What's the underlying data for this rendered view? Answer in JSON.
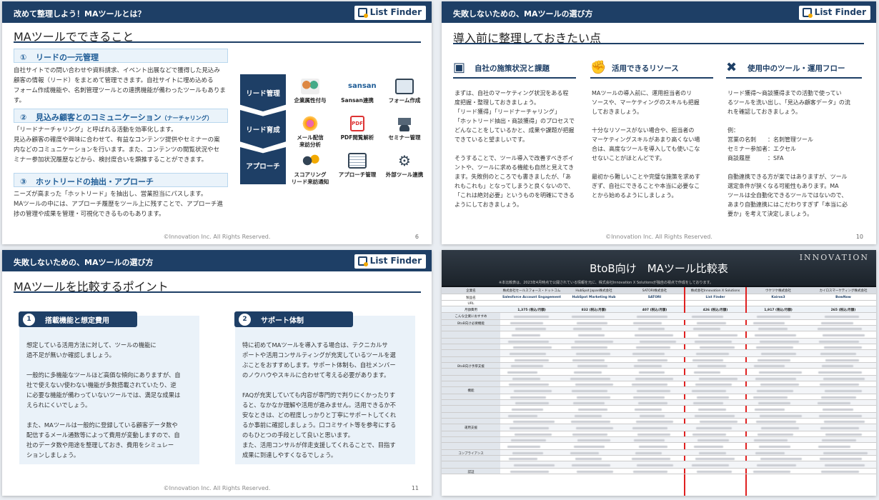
{
  "slide1": {
    "header": "改めて整理しよう！MAツールとは？",
    "logo": "List Finder",
    "title": "MAツールでできること",
    "sec1": {
      "num": "①",
      "label": "リードの一元管理"
    },
    "para1": [
      "自社サイトでの問い合わせや資料請求、イベント出展などで獲得した見込み",
      "顧客の情報（リード）をまとめて管理できます。自社サイトに埋め込める",
      "フォーム作成機能や、名刺管理ツールとの連携機能が備わったツールもありま",
      "す。"
    ],
    "sec2": {
      "num": "②",
      "label": "見込み顧客とのコミュニケーション",
      "sub": "（ナーチャリング）"
    },
    "para2": [
      "「リードナーチャリング」と呼ばれる活動を効率化します。",
      "見込み顧客の確度や興味に合わせて、有益なコンテンツ提供やセミナーの案",
      "内などのコミュニケーションを行います。また、コンテンツの閲覧状況やセ",
      "ミナー参加状況履歴などから、検討度合いを類推することができます。"
    ],
    "sec3": {
      "num": "③",
      "label": "ホットリードの抽出・アプローチ"
    },
    "para3": [
      "ニーズが高まった「ホットリード」を抽出し、営業担当にパスします。",
      "MAツールの中には、アプローチ履歴をツール上に残すことで、アプローチ進",
      "捗の管理や成果を管理・可視化できるものもあります。"
    ],
    "chevrons": [
      "リード管理",
      "リード育成",
      "アプローチ"
    ],
    "features": [
      [
        "企業属性付与"
      ],
      [
        "Sansan連携"
      ],
      [
        "フォーム作成"
      ],
      [
        "メール配信",
        "来訪分析"
      ],
      [
        "PDF閲覧解析"
      ],
      [
        "セミナー管理"
      ],
      [
        "スコアリング",
        "リード来訪通知"
      ],
      [
        "アプローチ管理"
      ],
      [
        "外部ツール連携"
      ]
    ],
    "sansan": "sansan",
    "footer": "©Innovation Inc. All Rights Reserved.",
    "page": "6"
  },
  "slide2": {
    "header": "失敗しないための、MAツールの選び方",
    "logo": "List Finder",
    "title": "導入前に整理しておきたい点",
    "col1": {
      "title": "自社の施策状況と課題",
      "lines": [
        "まずは、自社のマーケティング状況をある程",
        "度把握・整理しておきましょう。",
        "「リード獲得」「リードナーチャリング」",
        "「ホットリード抽出・商談獲得」のプロセスで",
        "どんなことをしているかと、成果や課題が把握",
        "できていると望ましいです。",
        "",
        "そうすることで、ツール導入で改善すべきポイ",
        "ントや、ツールに求める機能も自然と見えてき",
        "ます。失敗例のところでも書きましたが、「あ",
        "れもこれも」となってしまうと良くないので、",
        "「これは絶対必要」というものを明確にできる",
        "ようにしておきましょう。"
      ]
    },
    "col2": {
      "title": "活用できるリソース",
      "lines": [
        "MAツールの導入前に、運用担当者のリ",
        "ソースや、マーケティングのスキルも把握",
        "しておきましょう。",
        "",
        "十分なリソースがない場合や、担当者の",
        "マーケティングスキルがあまり高くない場",
        "合は、高度なツールを導入しても使いこな",
        "せないことがほとんどです。",
        "",
        "最初から難しいことや完璧な施策を求めす",
        "ぎず、自社にできることや本当に必要なこ",
        "とから始めるようにしましょう。"
      ]
    },
    "col3": {
      "title": "使用中のツール・運用フロー",
      "lines": [
        "リード獲得～商談獲得までの活動で使ってい",
        "るツールを洗い出し、「見込み顧客データ」の流",
        "れを確認しておきましょう。",
        "",
        "例：",
        "営業の名刺　　：名刺管理ツール",
        "セミナー参加者：エクセル",
        "商談履歴　　　：SFA",
        "",
        "自動連携できる方が楽ではありますが、ツール",
        "選定条件が狭くなる可能性もあります。MA",
        "ツールは全自動化できるツールではないので、",
        "あまり自動連携にはこだわりすぎず「本当に必",
        "要か」を考えて決定しましょう。"
      ]
    },
    "footer": "©Innovation Inc. All Rights Reserved.",
    "page": "10"
  },
  "slide3": {
    "header": "失敗しないための、MAツールの選び方",
    "logo": "List Finder",
    "title": "MAツールを比較するポイント",
    "box1": {
      "num": "1",
      "label": "搭載機能と想定費用",
      "lines": [
        "想定している活用方法に対して、ツールの機能に",
        "過不足が無いか確認しましょう。",
        "",
        "一般的に多機能なツールほど高価な傾向にありますが、自",
        "社で使えない/使わない機能が多数搭載されていたり、逆",
        "に必要な機能が備わっていないツールでは、満足な成果は",
        "えられにくいでしょう。",
        "",
        "また、MAツールは一般的に登録している顧客データ数や",
        "配信するメール通数等によって費用が変動しますので、自",
        "社のデータ数や用途を整理しておき、費用をシミュレー",
        "ションしましょう。"
      ]
    },
    "box2": {
      "num": "2",
      "label": "サポート体制",
      "lines": [
        "特に初めてMAツールを導入する場合は、テクニカルサ",
        "ポートや活用コンサルティングが充実しているツールを選",
        "ぶことをおすすめします。サポート体制も、自社メンバー",
        "のノウハウやスキルに合わせて考える必要があります。",
        "",
        "FAQが充実していても内容が専門的で判りにくかったりす",
        "ると、なかなか理解や活用が進みません。活用できるか不",
        "安なときは、どの程度しっかりと丁寧にサポートしてくれ",
        "るか事前に確認しましょう。口コミサイト等を参考にする",
        "のもひとつの手段として良いと思います。",
        "また、活用コンサルが伴走支援してくれることで、目指す",
        "成果に到達しやすくなるでしょう。"
      ]
    },
    "footer": "©Innovation Inc. All Rights Reserved.",
    "page": "11"
  },
  "slide4": {
    "brand": "INNOVATION",
    "title": "BtoB向け　MAツール比較表",
    "note": "※本比較表は、2023年4月時点で公開されている情報を元に、株式会社Innovation X Solutionsが独自の視点で作成をしております。",
    "corner": "企業名",
    "vendors": [
      "株式会社セールスフォース・ドットコム",
      "HubSpot Japan株式会社",
      "SATORI株式会社",
      "株式会社Innovation X Solutions",
      "ウケツケ株式会社",
      "カイロスマーケティング株式会社"
    ],
    "products": [
      "Salesforce Account Engagement",
      "HubSpot Marketing Hub",
      "SATORI",
      "List Finder",
      "Kairos3",
      "BowNow"
    ],
    "prices": [
      "1,375 (税込/月額)",
      "832 (税込/月額)",
      "407 (税込/月額)",
      "426 (税込/月額)",
      "1,917 (税込/月額)",
      "265 (税込/月額)"
    ],
    "row_labels": [
      "製品名",
      "URL",
      "月額費用",
      "こんな企業におすすめ",
      "BtoB向け必要機能",
      "",
      "",
      "",
      "",
      "",
      "",
      "BtoB向け手厚支援",
      "",
      "",
      "",
      "機能",
      "",
      "",
      "",
      "",
      "",
      "運用支援",
      "",
      "",
      "",
      "コンプライアンス",
      "",
      "",
      "認証"
    ]
  }
}
